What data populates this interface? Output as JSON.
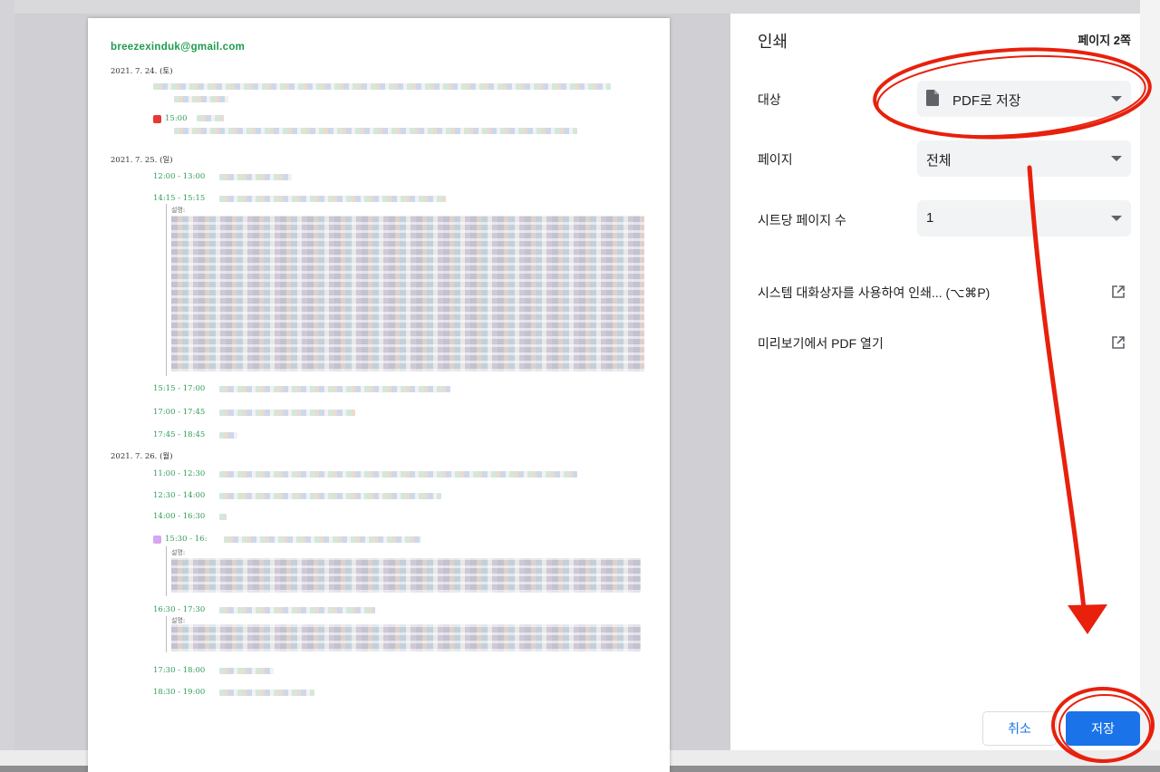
{
  "preview": {
    "email": "breezexinduk@gmail.com",
    "dates": [
      "2021. 7. 24. (토)",
      "2021. 7. 25. (일)",
      "2021. 7. 26. (월)"
    ],
    "times": [
      "12:00 - 13:00",
      "14:15 - 15:15",
      "15:15 - 17:00",
      "17:00 - 17:45",
      "17:45 - 18:45",
      "11:00 - 12:30",
      "12:30 - 14:00",
      "14:00 - 16:30",
      "15:30 - 16:",
      "16:30 - 17:30",
      "17:30 - 18:00",
      "18:30 - 19:00"
    ],
    "event_times_24": [
      "15:00"
    ],
    "notes": [
      "설명:",
      "설명:",
      "설명:"
    ],
    "marker_colors": {
      "red": "#e53935",
      "purple": "#d6a6f2"
    }
  },
  "panel": {
    "title": "인쇄",
    "page_count": "페이지 2쪽",
    "destination": {
      "label": "대상",
      "value": "PDF로 저장",
      "icon": "file-icon"
    },
    "pages": {
      "label": "페이지",
      "value": "전체"
    },
    "pages_per_sheet": {
      "label": "시트당 페이지 수",
      "value": "1"
    },
    "system_dialog": "시스템 대화상자를 사용하여 인쇄... (⌥⌘P)",
    "open_preview": "미리보기에서 PDF 열기",
    "cancel": "취소",
    "save": "저장",
    "accent_color": "#1a73e8",
    "annotation_color": "#e8200c"
  }
}
